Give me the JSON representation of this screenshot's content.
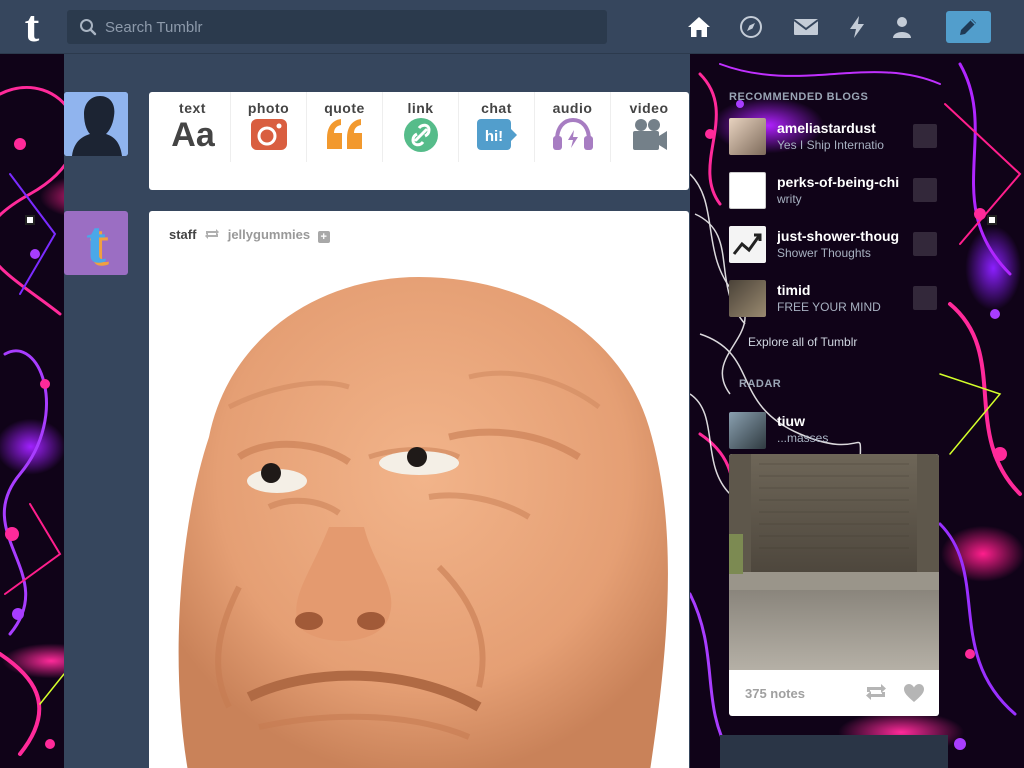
{
  "search": {
    "placeholder": "Search Tumblr"
  },
  "post_types": [
    {
      "label": "text",
      "icon": "text-icon",
      "glyph": "Aa",
      "color": "#444444"
    },
    {
      "label": "photo",
      "icon": "camera-icon",
      "color": "#d95e40"
    },
    {
      "label": "quote",
      "icon": "quote-icon",
      "glyph": "66",
      "color": "#f2992e"
    },
    {
      "label": "link",
      "icon": "link-icon",
      "color": "#56bc8a"
    },
    {
      "label": "chat",
      "icon": "chat-icon",
      "glyph": "hi!",
      "color": "#529ecc"
    },
    {
      "label": "audio",
      "icon": "headphones-icon",
      "color": "#a77dc2"
    },
    {
      "label": "video",
      "icon": "video-camera-icon",
      "color": "#748089"
    }
  ],
  "post": {
    "author": "staff",
    "reblogged_from": "jellygummies",
    "follow_glyph": "+"
  },
  "sidebar": {
    "title": "RECOMMENDED BLOGS",
    "blogs": [
      {
        "name": "ameliastardust",
        "desc": "Yes I Ship Internatio"
      },
      {
        "name": "perks-of-being-chi",
        "desc": "writy"
      },
      {
        "name": "just-shower-thoug",
        "desc": "Shower Thoughts"
      },
      {
        "name": "timid",
        "desc": "FREE YOUR MIND"
      }
    ],
    "explore": "Explore all of Tumblr",
    "radar_title": "RADAR",
    "radar_blog": {
      "name": "tiuw",
      "desc": "...masses"
    },
    "radar_post": {
      "notes": "375 notes"
    }
  },
  "colors": {
    "nav_bg": "#36465d",
    "accent": "#529ecc"
  }
}
